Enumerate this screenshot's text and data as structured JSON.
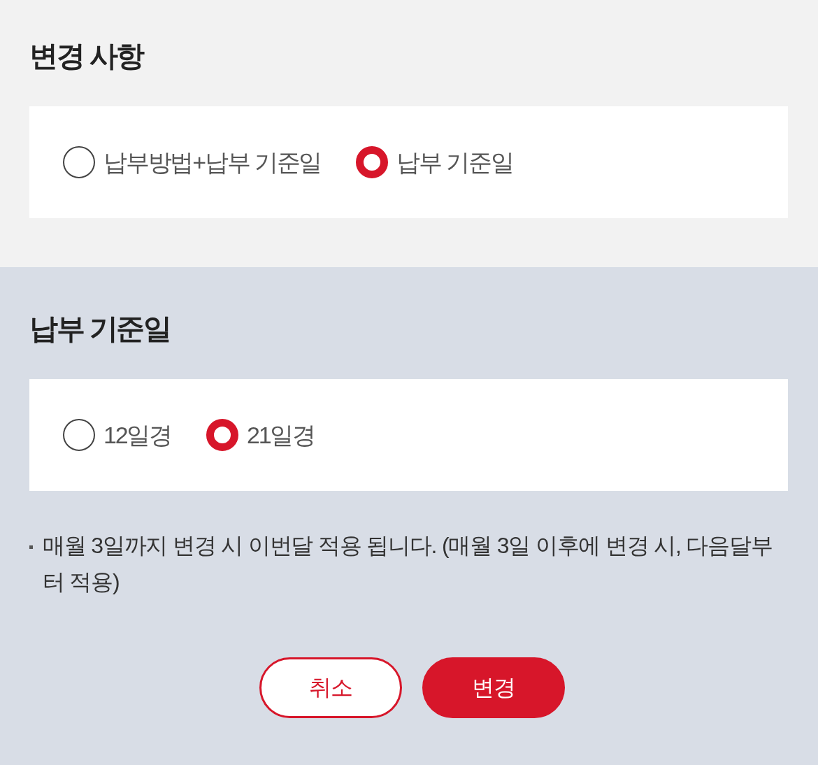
{
  "change_section": {
    "title": "변경 사항",
    "options": [
      {
        "label": "납부방법+납부 기준일",
        "selected": false
      },
      {
        "label": "납부 기준일",
        "selected": true
      }
    ]
  },
  "date_section": {
    "title": "납부 기준일",
    "options": [
      {
        "label": "12일경",
        "selected": false
      },
      {
        "label": "21일경",
        "selected": true
      }
    ],
    "note": "매월 3일까지 변경 시 이번달 적용 됩니다. (매월 3일 이후에 변경 시, 다음달부터 적용)"
  },
  "buttons": [
    {
      "kind": "secondary",
      "label": "취소"
    },
    {
      "kind": "primary",
      "label": "변경"
    }
  ]
}
